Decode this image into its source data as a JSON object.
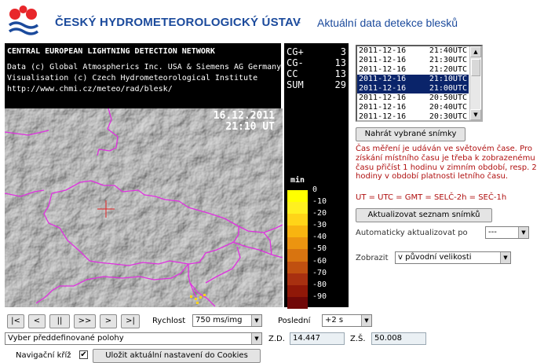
{
  "header": {
    "org_title": "ČESKÝ HYDROMETEOROLOGICKÝ ÚSTAV",
    "separator": "-",
    "subtitle": "Aktuální data detekce blesků"
  },
  "info": {
    "heading": "CENTRAL EUROPEAN LIGHTNING DETECTION NETWORK",
    "line1": "Data (c) Global Atmospherics Inc. USA & Siemens AG Germany",
    "line2": "Visualisation (c) Czech Hydrometeorological Institute",
    "line3": "http://www.chmi.cz/meteo/rad/blesk/"
  },
  "counts": [
    {
      "label": "CG+",
      "value": "3"
    },
    {
      "label": "CG-",
      "value": "13"
    },
    {
      "label": "CC",
      "value": "13"
    },
    {
      "label": "SUM",
      "value": "29"
    }
  ],
  "map": {
    "date": "16.12.2011",
    "time": "21:10 UT"
  },
  "legend": {
    "title": "min",
    "items": [
      {
        "label": "0",
        "color": "#ffff00"
      },
      {
        "label": "-10",
        "color": "#fff020"
      },
      {
        "label": "-20",
        "color": "#ffd418"
      },
      {
        "label": "-30",
        "color": "#f8b410"
      },
      {
        "label": "-40",
        "color": "#ec9410"
      },
      {
        "label": "-50",
        "color": "#d87410"
      },
      {
        "label": "-60",
        "color": "#c05010"
      },
      {
        "label": "-70",
        "color": "#a83010"
      },
      {
        "label": "-80",
        "color": "#901808"
      },
      {
        "label": "-90",
        "color": "#700808"
      }
    ]
  },
  "time_list": [
    {
      "date": "2011-12-16",
      "time": "21:40UTC",
      "selected": false
    },
    {
      "date": "2011-12-16",
      "time": "21:30UTC",
      "selected": false
    },
    {
      "date": "2011-12-16",
      "time": "21:20UTC",
      "selected": false
    },
    {
      "date": "2011-12-16",
      "time": "21:10UTC",
      "selected": true
    },
    {
      "date": "2011-12-16",
      "time": "21:00UTC",
      "selected": true
    },
    {
      "date": "2011-12-16",
      "time": "20:50UTC",
      "selected": false
    },
    {
      "date": "2011-12-16",
      "time": "20:40UTC",
      "selected": false
    },
    {
      "date": "2011-12-16",
      "time": "20:30UTC",
      "selected": false
    }
  ],
  "buttons": {
    "load_selected": "Nahrát vybrané snímky",
    "refresh_list": "Aktualizovat seznam snímků",
    "save_cookies": "Uložit aktuální nastavení do Cookies"
  },
  "note": {
    "text": "Čas měření je udáván ve světovém čase. Pro získání místního času je třeba k zobrazenému času přičíst 1 hodinu v zimním období, resp. 2 hodiny v období platnosti letního času.",
    "ut": "UT = UTC = GMT = SELČ-2h = SEČ-1h"
  },
  "auto_update": {
    "label": "Automaticky aktualizovat po",
    "value": "---"
  },
  "display": {
    "label": "Zobrazit",
    "value": "v původní velikosti"
  },
  "player": {
    "first": "|<",
    "prev": "<",
    "pause": "||",
    "play": ">>",
    "next": ">",
    "last": ">|",
    "speed_label": "Rychlost",
    "speed_value": "750 ms/img",
    "last_label": "Poslední",
    "last_value": "+2 s"
  },
  "position": {
    "preset": "Vyber předdefinované polohy",
    "lon_label": "Z.D.",
    "lon": "14.447",
    "lat_label": "Z.Š.",
    "lat": "50.008"
  },
  "nav_cross": {
    "label": "Navigační kříž",
    "checked": "✔"
  }
}
